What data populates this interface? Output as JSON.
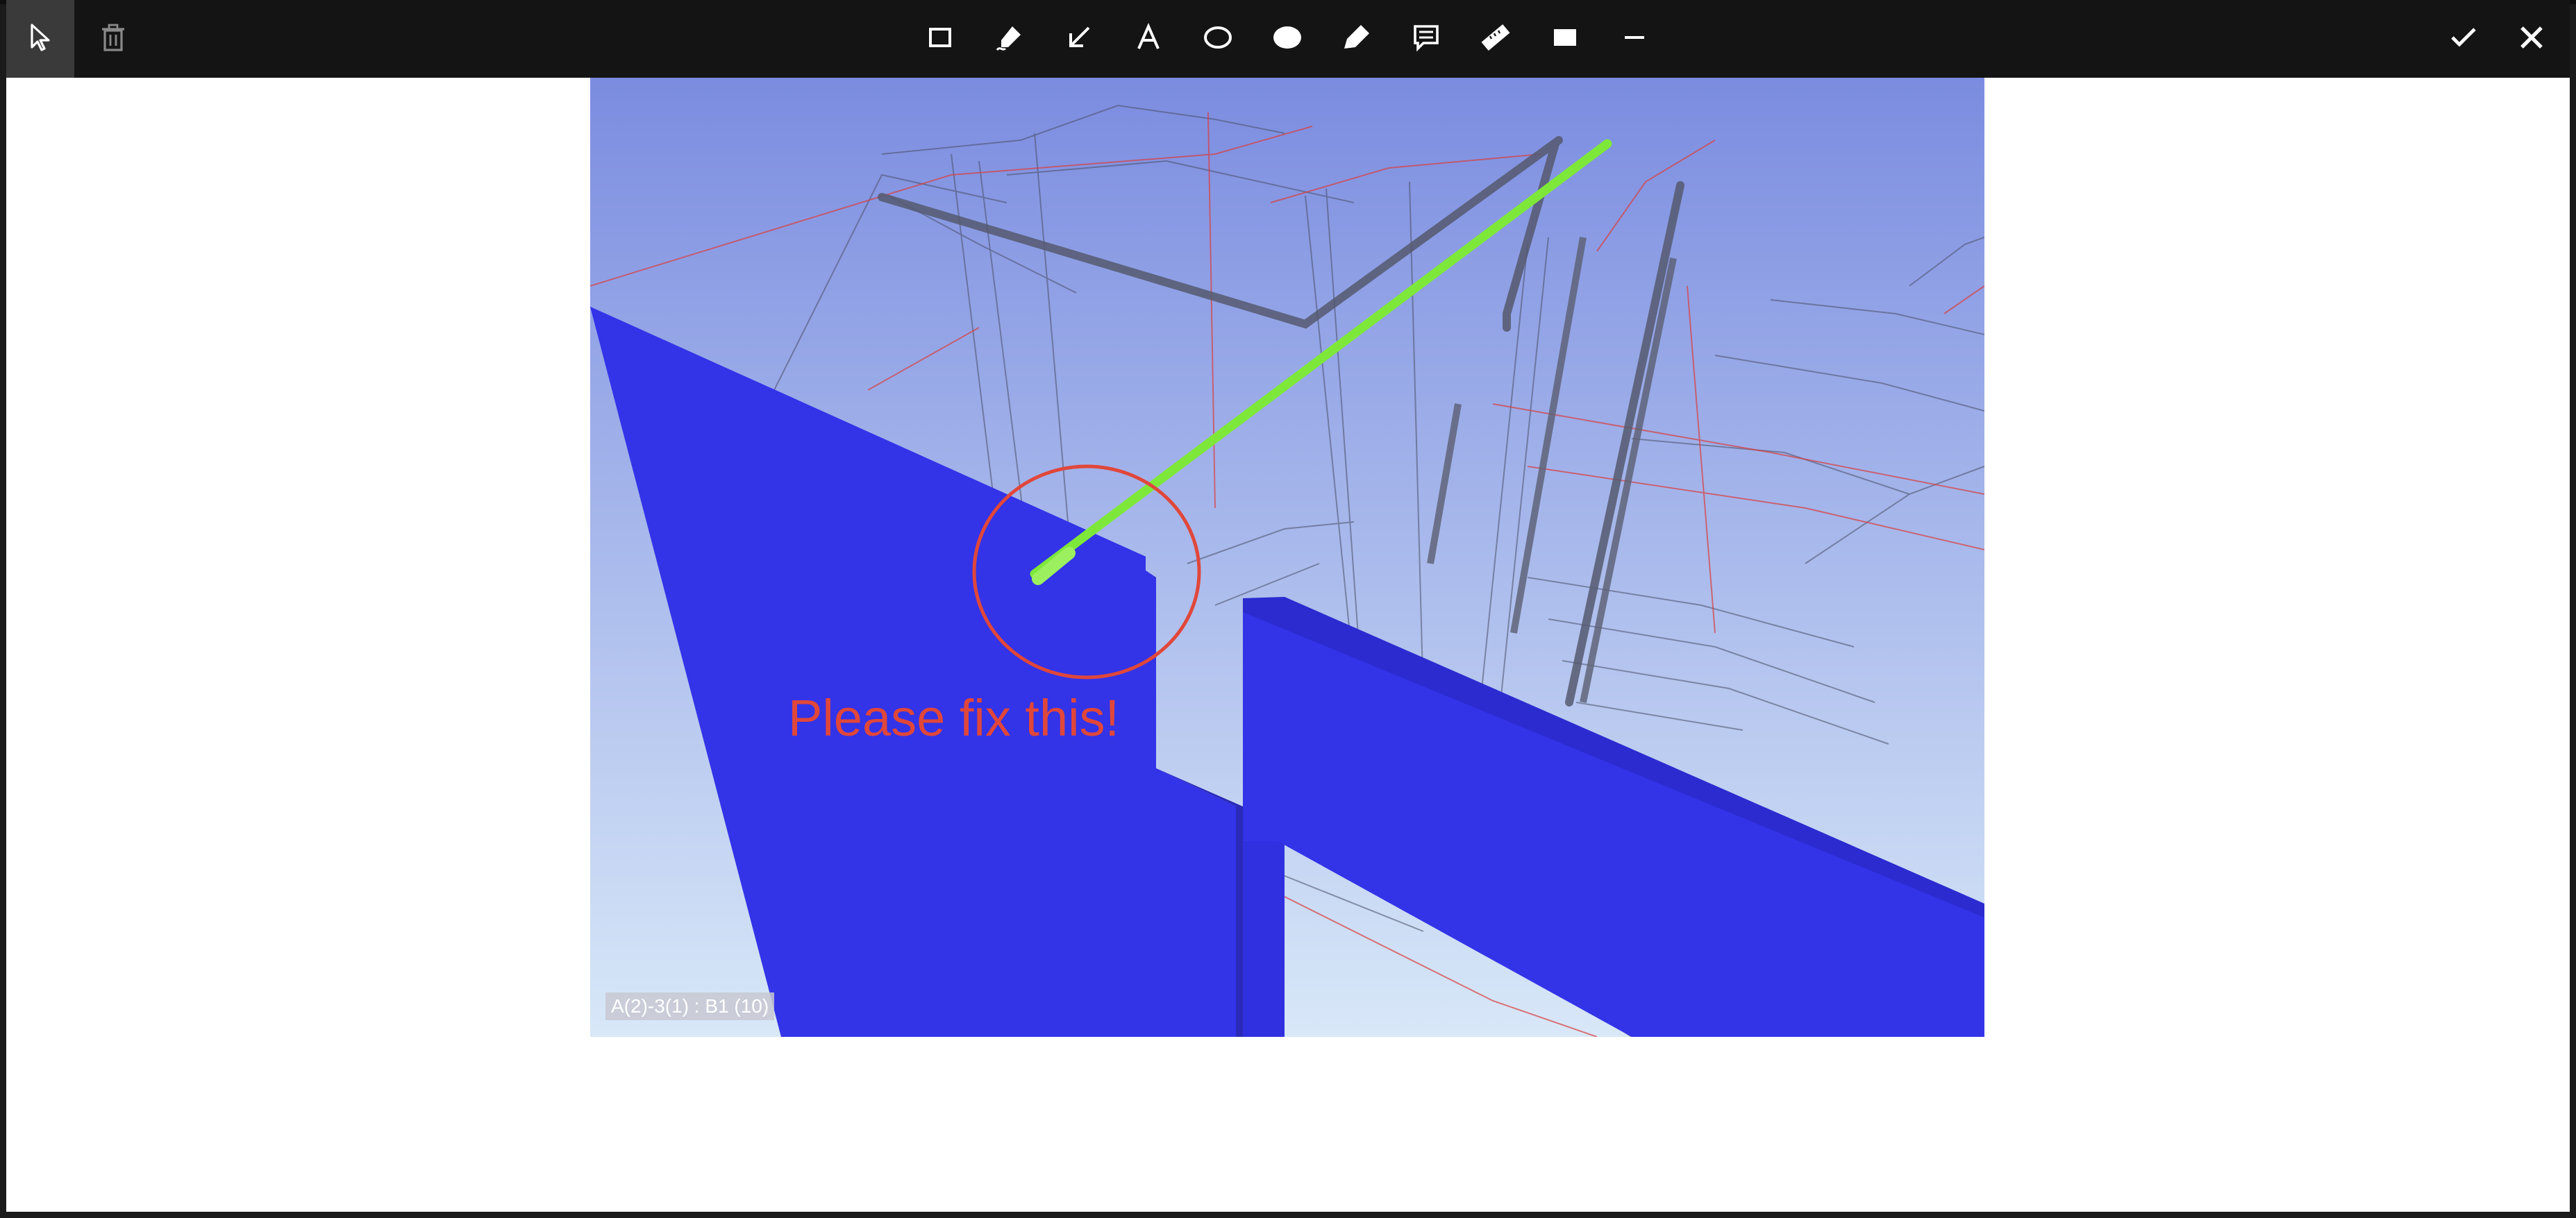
{
  "toolbar": {
    "left_tools": [
      {
        "name": "select-tool",
        "icon": "cursor-arrow-icon",
        "active": true
      },
      {
        "name": "delete-tool",
        "icon": "trash-icon",
        "active": false
      }
    ],
    "center_tools": [
      {
        "name": "rectangle-tool",
        "icon": "rectangle-outline-icon"
      },
      {
        "name": "freehand-tool",
        "icon": "pen-stroke-icon"
      },
      {
        "name": "arrow-tool",
        "icon": "arrow-down-left-icon"
      },
      {
        "name": "text-tool",
        "icon": "text-a-icon",
        "glyph": "A"
      },
      {
        "name": "ellipse-tool",
        "icon": "ellipse-outline-icon"
      },
      {
        "name": "filled-ellipse-tool",
        "icon": "ellipse-filled-icon"
      },
      {
        "name": "highlighter-tool",
        "icon": "highlighter-icon"
      },
      {
        "name": "comment-tool",
        "icon": "comment-bubble-icon"
      },
      {
        "name": "measure-tool",
        "icon": "ruler-icon"
      },
      {
        "name": "filled-rectangle-tool",
        "icon": "rectangle-filled-icon"
      },
      {
        "name": "line-tool",
        "icon": "line-icon"
      }
    ],
    "right_tools": [
      {
        "name": "confirm-button",
        "icon": "check-icon"
      },
      {
        "name": "close-button",
        "icon": "close-icon"
      }
    ]
  },
  "canvas": {
    "annotation_text": "Please fix this!",
    "level_label": "A(2)-3(1) : B1 (10)",
    "colors": {
      "sky_top": "#7b8ce0",
      "sky_bottom": "#d8e8f8",
      "wall": "#3333e8",
      "pipe": "#7ee83a",
      "annotation": "#e0473a"
    }
  }
}
